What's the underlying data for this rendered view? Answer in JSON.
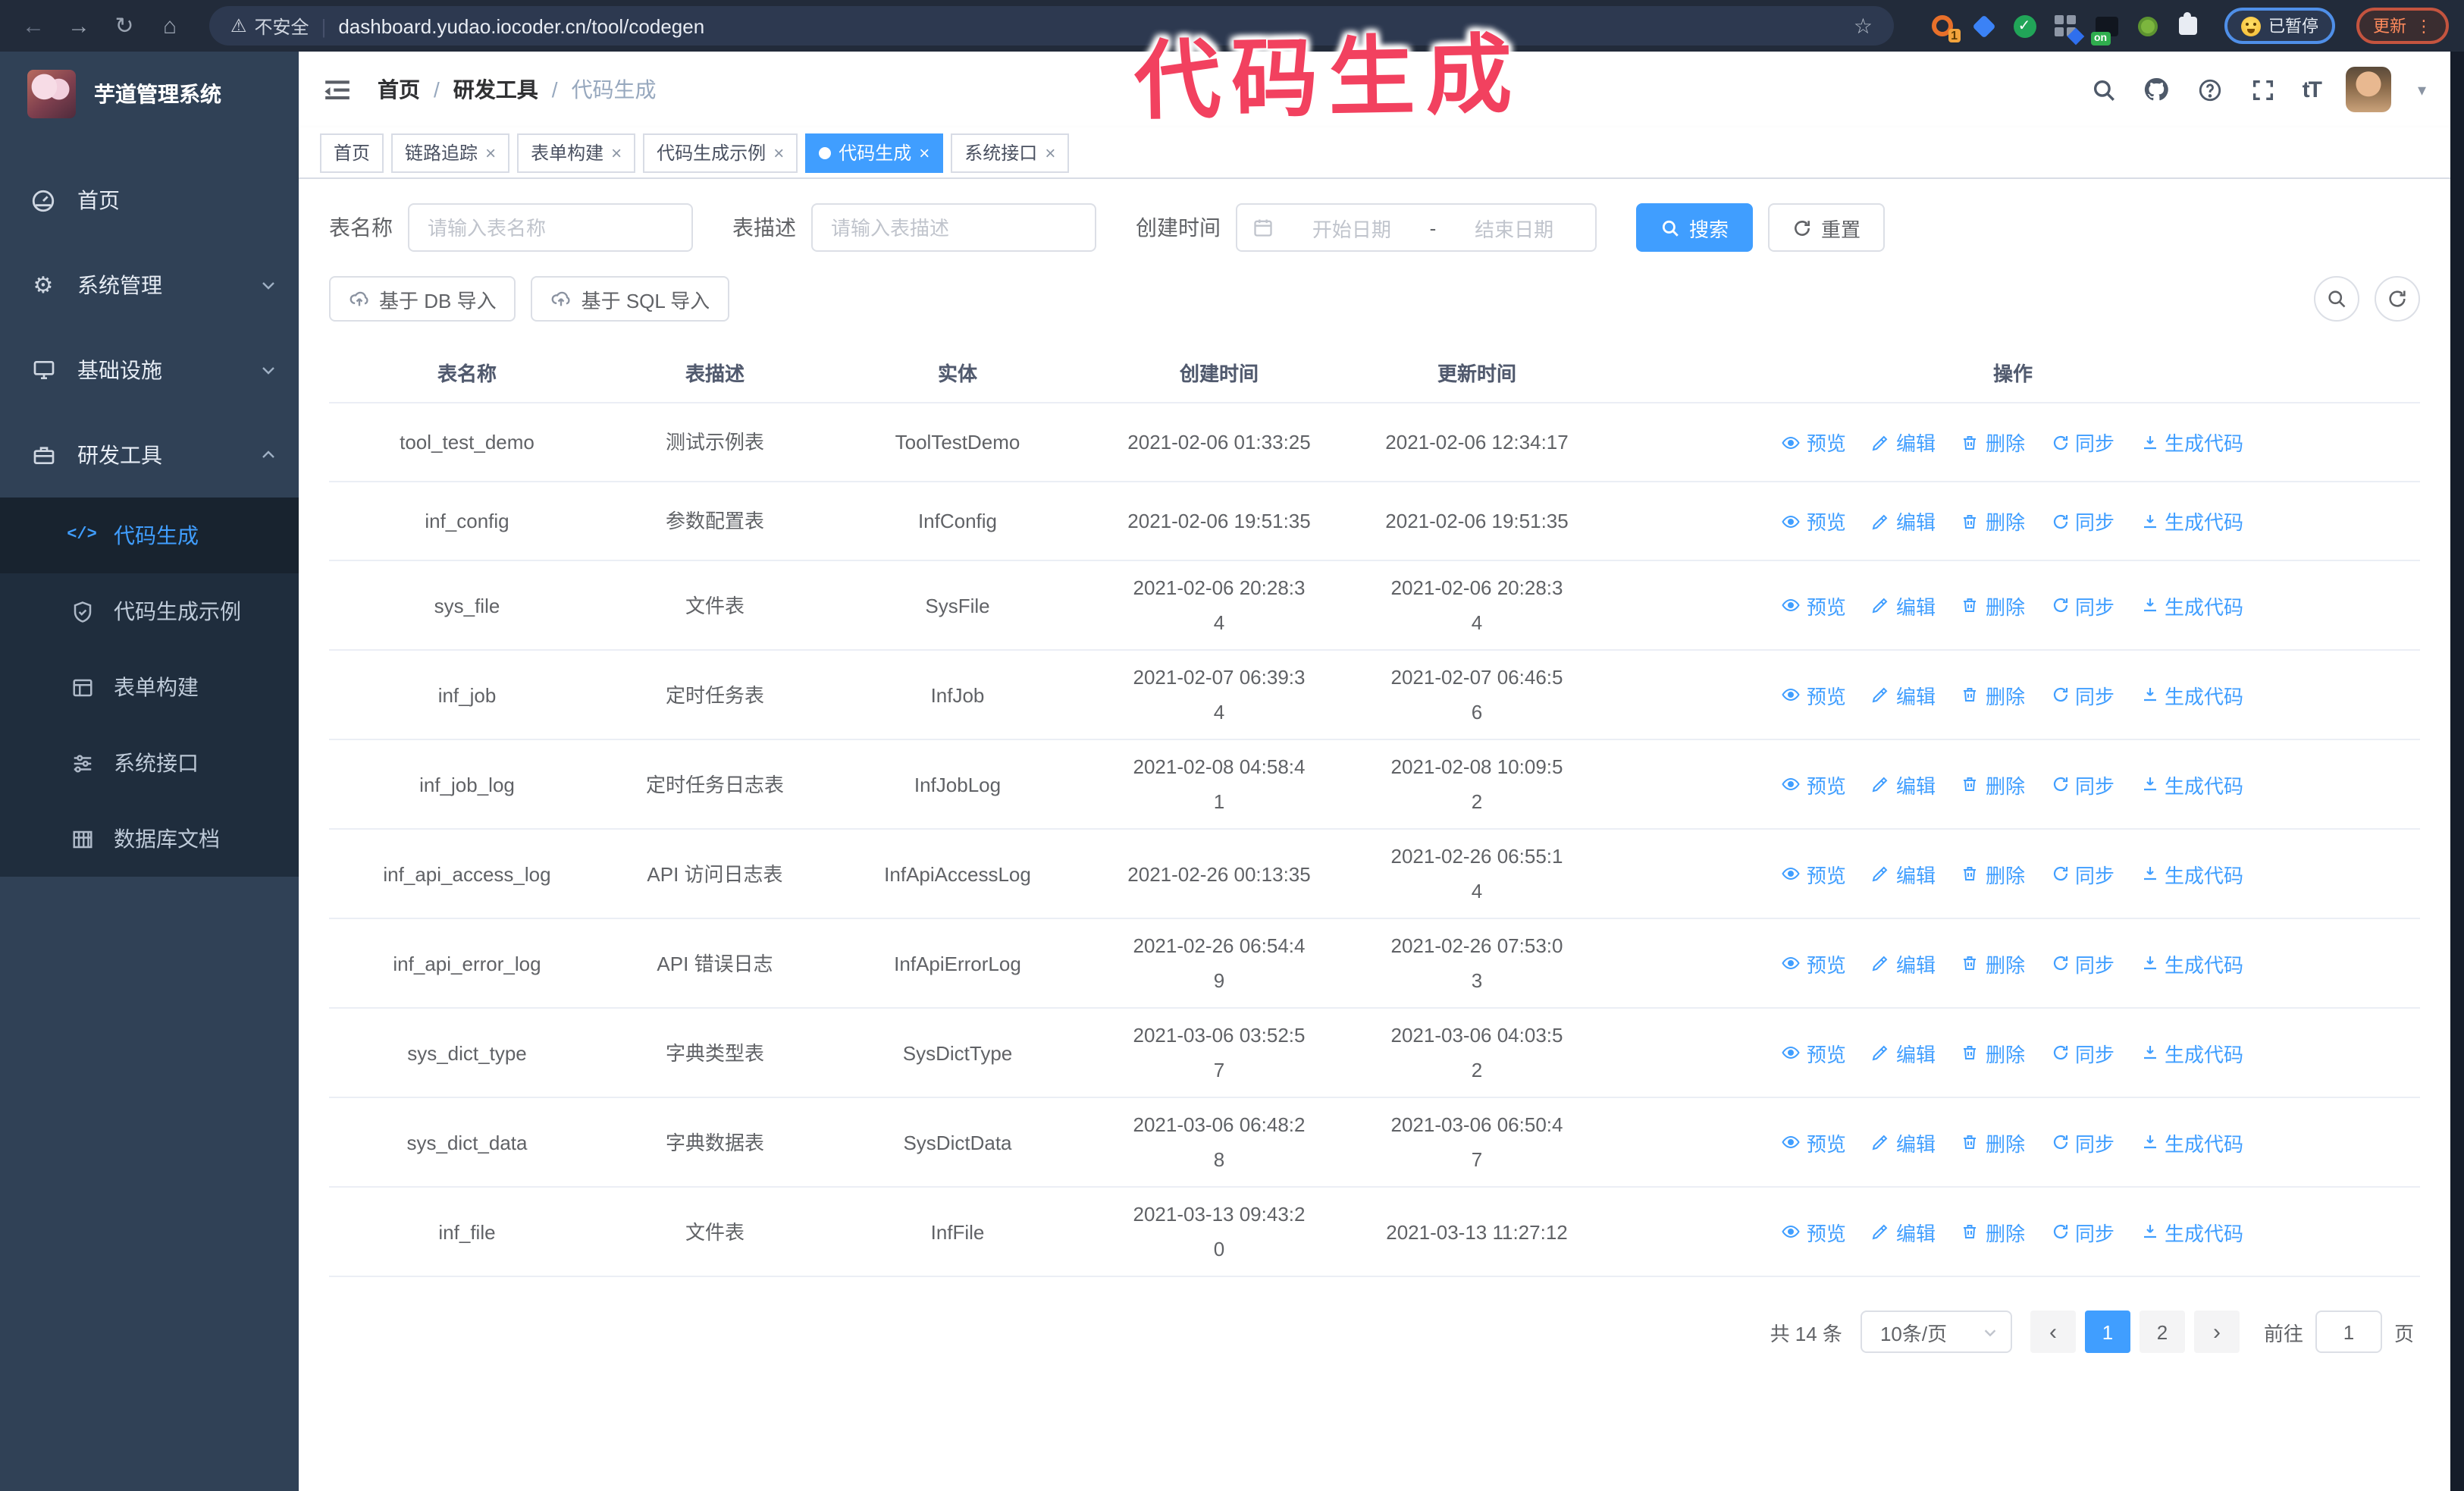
{
  "browser": {
    "security_label": "不安全",
    "url": "dashboard.yudao.iocoder.cn/tool/codegen",
    "separator": "|",
    "extension_badge": "1",
    "on_badge": "on",
    "paused_label": "已暂停",
    "update_label": "更新"
  },
  "annotation": {
    "text": "代码生成",
    "color": "#f2415f"
  },
  "sidebar": {
    "title": "芋道管理系统",
    "items": [
      {
        "label": "首页"
      },
      {
        "label": "系统管理"
      },
      {
        "label": "基础设施"
      },
      {
        "label": "研发工具"
      }
    ],
    "sub_items": [
      {
        "label": "代码生成"
      },
      {
        "label": "代码生成示例"
      },
      {
        "label": "表单构建"
      },
      {
        "label": "系统接口"
      },
      {
        "label": "数据库文档"
      }
    ]
  },
  "header": {
    "breadcrumb": [
      "首页",
      "研发工具",
      "代码生成"
    ],
    "breadcrumb_separator": "/"
  },
  "tags": [
    {
      "label": "首页",
      "closable": false,
      "active": false
    },
    {
      "label": "链路追踪",
      "closable": true,
      "active": false
    },
    {
      "label": "表单构建",
      "closable": true,
      "active": false
    },
    {
      "label": "代码生成示例",
      "closable": true,
      "active": false
    },
    {
      "label": "代码生成",
      "closable": true,
      "active": true
    },
    {
      "label": "系统接口",
      "closable": true,
      "active": false
    }
  ],
  "filters": {
    "name_label": "表名称",
    "name_placeholder": "请输入表名称",
    "desc_label": "表描述",
    "desc_placeholder": "请输入表描述",
    "time_label": "创建时间",
    "start_placeholder": "开始日期",
    "range_separator": "-",
    "end_placeholder": "结束日期",
    "search_label": "搜索",
    "reset_label": "重置"
  },
  "toolbar": {
    "import_db_label": "基于 DB 导入",
    "import_sql_label": "基于 SQL 导入"
  },
  "table": {
    "columns": [
      "表名称",
      "表描述",
      "实体",
      "创建时间",
      "更新时间",
      "操作"
    ],
    "ops": [
      "预览",
      "编辑",
      "删除",
      "同步",
      "生成代码"
    ],
    "rows": [
      {
        "name": "tool_test_demo",
        "desc": "测试示例表",
        "entity": "ToolTestDemo",
        "created": [
          "2021-02-06 01:33:25"
        ],
        "updated": [
          "2021-02-06 12:34:17"
        ]
      },
      {
        "name": "inf_config",
        "desc": "参数配置表",
        "entity": "InfConfig",
        "created": [
          "2021-02-06 19:51:35"
        ],
        "updated": [
          "2021-02-06 19:51:35"
        ]
      },
      {
        "name": "sys_file",
        "desc": "文件表",
        "entity": "SysFile",
        "created": [
          "2021-02-06 20:28:3",
          "4"
        ],
        "updated": [
          "2021-02-06 20:28:3",
          "4"
        ]
      },
      {
        "name": "inf_job",
        "desc": "定时任务表",
        "entity": "InfJob",
        "created": [
          "2021-02-07 06:39:3",
          "4"
        ],
        "updated": [
          "2021-02-07 06:46:5",
          "6"
        ]
      },
      {
        "name": "inf_job_log",
        "desc": "定时任务日志表",
        "entity": "InfJobLog",
        "created": [
          "2021-02-08 04:58:4",
          "1"
        ],
        "updated": [
          "2021-02-08 10:09:5",
          "2"
        ]
      },
      {
        "name": "inf_api_access_log",
        "desc": "API 访问日志表",
        "entity": "InfApiAccessLog",
        "created": [
          "2021-02-26 00:13:35"
        ],
        "updated": [
          "2021-02-26 06:55:1",
          "4"
        ]
      },
      {
        "name": "inf_api_error_log",
        "desc": "API 错误日志",
        "entity": "InfApiErrorLog",
        "created": [
          "2021-02-26 06:54:4",
          "9"
        ],
        "updated": [
          "2021-02-26 07:53:0",
          "3"
        ]
      },
      {
        "name": "sys_dict_type",
        "desc": "字典类型表",
        "entity": "SysDictType",
        "created": [
          "2021-03-06 03:52:5",
          "7"
        ],
        "updated": [
          "2021-03-06 04:03:5",
          "2"
        ]
      },
      {
        "name": "sys_dict_data",
        "desc": "字典数据表",
        "entity": "SysDictData",
        "created": [
          "2021-03-06 06:48:2",
          "8"
        ],
        "updated": [
          "2021-03-06 06:50:4",
          "7"
        ]
      },
      {
        "name": "inf_file",
        "desc": "文件表",
        "entity": "InfFile",
        "created": [
          "2021-03-13 09:43:2",
          "0"
        ],
        "updated": [
          "2021-03-13 11:27:12"
        ]
      }
    ]
  },
  "pagination": {
    "total_label": "共 14 条",
    "page_size_label": "10条/页",
    "pages": [
      "1",
      "2"
    ],
    "active_page": "1",
    "goto_label": "前往",
    "goto_value": "1",
    "page_unit_label": "页"
  },
  "glyphs": {
    "back": "←",
    "forward": "→",
    "reload": "↻",
    "home": "⌂",
    "star": "☆",
    "warning": "⚠",
    "dots": "⋮",
    "caret_down": "▾",
    "close": "×",
    "prev": "‹",
    "next": "›",
    "gear": "⚙",
    "code": "</>",
    "check": "✓",
    "font_size": "tT"
  },
  "colors": {
    "accent": "#409eff",
    "sidebar_bg": "#304156",
    "submenu_bg": "#1f2d3d",
    "annotation": "#f2415f"
  }
}
